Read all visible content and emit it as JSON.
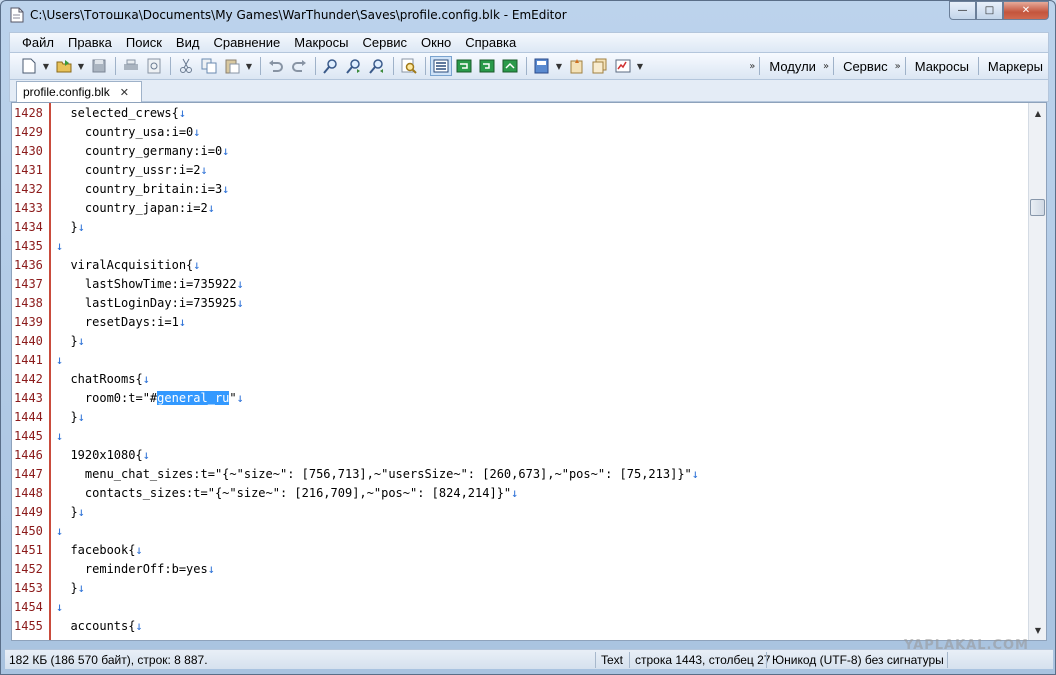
{
  "window": {
    "title": "C:\\Users\\Тотошка\\Documents\\My Games\\WarThunder\\Saves\\profile.config.blk - EmEditor",
    "controls": {
      "minimize": "—",
      "maximize": "□",
      "close": "✕"
    }
  },
  "menu": [
    "Файл",
    "Правка",
    "Поиск",
    "Вид",
    "Сравнение",
    "Макросы",
    "Сервис",
    "Окно",
    "Справка"
  ],
  "toolbar": {
    "panels": [
      "Модули",
      "Сервис",
      "Макросы",
      "Маркеры"
    ],
    "chevron": "»"
  },
  "tab": {
    "label": "profile.config.blk",
    "close": "✕"
  },
  "editor": {
    "line_end_marker": "↓",
    "lines": [
      {
        "n": "1428",
        "text": "  selected_crews{"
      },
      {
        "n": "1429",
        "text": "    country_usa:i=0"
      },
      {
        "n": "1430",
        "text": "    country_germany:i=0"
      },
      {
        "n": "1431",
        "text": "    country_ussr:i=2"
      },
      {
        "n": "1432",
        "text": "    country_britain:i=3"
      },
      {
        "n": "1433",
        "text": "    country_japan:i=2"
      },
      {
        "n": "1434",
        "text": "  }"
      },
      {
        "n": "1435",
        "text": ""
      },
      {
        "n": "1436",
        "text": "  viralAcquisition{"
      },
      {
        "n": "1437",
        "text": "    lastShowTime:i=735922"
      },
      {
        "n": "1438",
        "text": "    lastLoginDay:i=735925"
      },
      {
        "n": "1439",
        "text": "    resetDays:i=1"
      },
      {
        "n": "1440",
        "text": "  }"
      },
      {
        "n": "1441",
        "text": ""
      },
      {
        "n": "1442",
        "text": "  chatRooms{"
      },
      {
        "n": "1443",
        "text": "    room0:t=\"#",
        "selected": "general_ru",
        "after": "\""
      },
      {
        "n": "1444",
        "text": "  }"
      },
      {
        "n": "1445",
        "text": ""
      },
      {
        "n": "1446",
        "text": "  1920x1080{"
      },
      {
        "n": "1447",
        "text": "    menu_chat_sizes:t=\"{~\"size~\": [756,713],~\"usersSize~\": [260,673],~\"pos~\": [75,213]}\""
      },
      {
        "n": "1448",
        "text": "    contacts_sizes:t=\"{~\"size~\": [216,709],~\"pos~\": [824,214]}\""
      },
      {
        "n": "1449",
        "text": "  }"
      },
      {
        "n": "1450",
        "text": ""
      },
      {
        "n": "1451",
        "text": "  facebook{"
      },
      {
        "n": "1452",
        "text": "    reminderOff:b=yes"
      },
      {
        "n": "1453",
        "text": "  }"
      },
      {
        "n": "1454",
        "text": ""
      },
      {
        "n": "1455",
        "text": "  accounts{"
      }
    ]
  },
  "status": {
    "file_info": "182 КБ (186 570 байт), строк: 8 887.",
    "mode": "Text",
    "position": "строка 1443, столбец 27",
    "encoding": "Юникод (UTF-8) без сигнатуры"
  },
  "watermark": "YAPLAKAL.COM",
  "colors": {
    "line_number": "#8b1a1a",
    "line_end_arrow": "#2a6fd6",
    "selection": "#3399ff",
    "gutter_border": "#c94b3c"
  }
}
